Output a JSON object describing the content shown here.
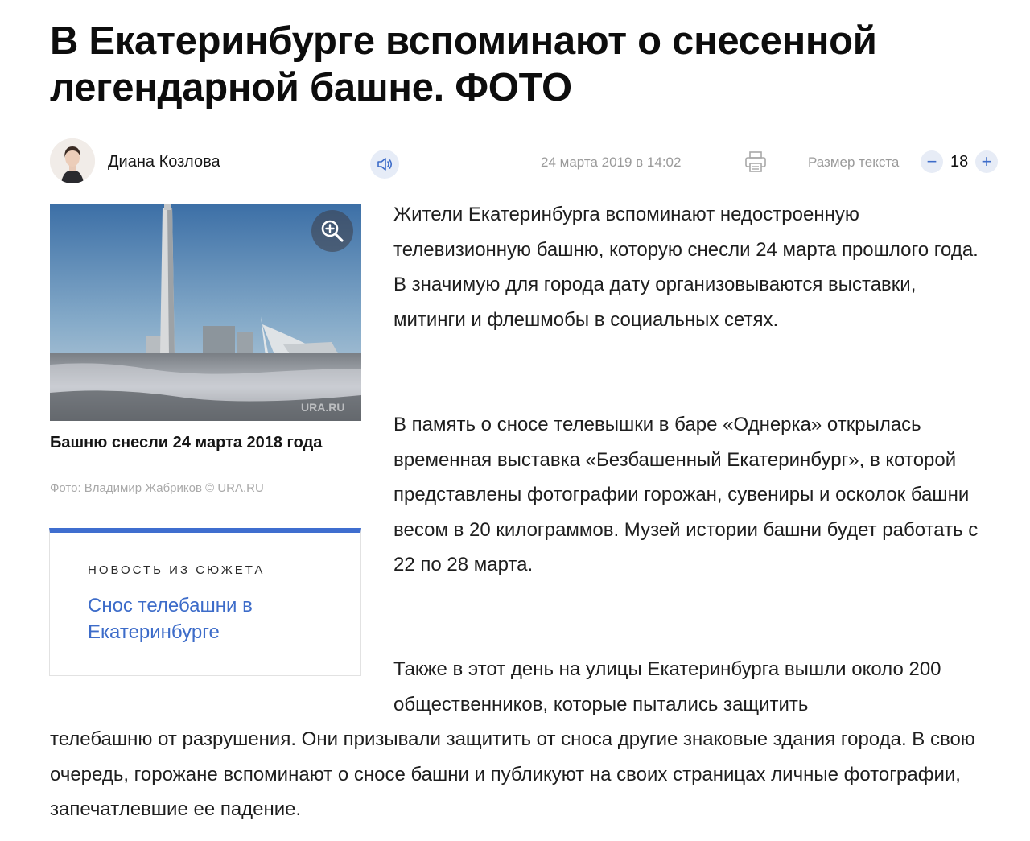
{
  "article": {
    "title": "В Екатеринбурге вспоминают о снесенной легендарной башне. ФОТО",
    "author": "Диана Козлова",
    "date": "24 марта 2019 в 14:02",
    "text_size_label": "Размер текста",
    "text_size_value": "18",
    "minus_label": "−",
    "plus_label": "+"
  },
  "photo": {
    "caption": "Башню снесли 24 марта 2018 года",
    "credit": "Фото: Владимир Жабриков © URA.RU",
    "watermark": "URA.RU"
  },
  "story": {
    "kicker": "НОВОСТЬ ИЗ СЮЖЕТА",
    "link": "Снос телебашни в Екатеринбурге"
  },
  "body": {
    "p1": "Жители Екатеринбурга вспоминают недостроенную телевизионную башню, которую снесли 24 марта прошлого года. В значимую для города дату организовываются выставки, митинги и флешмобы в социальных сетях.",
    "p2": "В память о сносе телевышки в баре «Однерка» открылась временная выставка «Безбашенный Екатеринбург», в которой представлены фотографии горожан, сувениры и осколок башни весом в 20 килограммов. Музей истории башни будет работать с 22 по 28 марта.",
    "p3_line1": "Также в этот день на улицы Екатеринбурга вышли около 200 общественников, которые пытались защитить",
    "p3_rest": "телебашню от разрушения. Они призывали защитить от сноса другие знаковые здания города. В свою очередь, горожане вспоминают о сносе башни и публикуют на своих страницах личные фотографии, запечатлевшие ее падение."
  },
  "icons": {
    "audio": "speaker-icon",
    "print": "printer-icon",
    "zoom": "zoom-in-icon"
  },
  "colors": {
    "accent": "#3d6cc9",
    "story_border": "#3f6ecf",
    "muted": "#9a9a9a"
  }
}
